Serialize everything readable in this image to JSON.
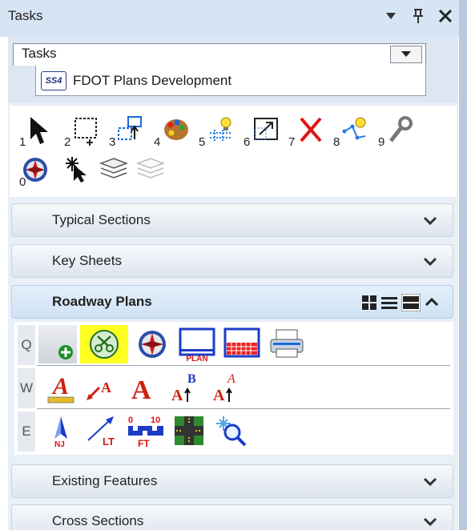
{
  "window": {
    "title": "Tasks"
  },
  "tasks_dropdown": {
    "tab_label": "Tasks",
    "selected": "FDOT Plans Development",
    "logo_text": "SS4"
  },
  "main_tools": {
    "numbers": [
      "1",
      "2",
      "3",
      "4",
      "5",
      "6",
      "7",
      "8",
      "9",
      "0"
    ]
  },
  "sections": {
    "typical": "Typical Sections",
    "key": "Key Sheets",
    "roadway": "Roadway Plans",
    "existing": "Existing Features",
    "cross": "Cross Sections"
  },
  "roadway_rows": {
    "q": "Q",
    "w": "W",
    "e": "E"
  },
  "icon_text": {
    "plan": "PLAN",
    "lt": "LT",
    "ft": "FT",
    "scale_start": "0",
    "scale_end": "10",
    "nj": "NJ",
    "sup_b": "B"
  },
  "colors": {
    "titlebar": "#d7e4f4",
    "highlight": "#ffff22",
    "active_header": "#cfe2f5"
  }
}
